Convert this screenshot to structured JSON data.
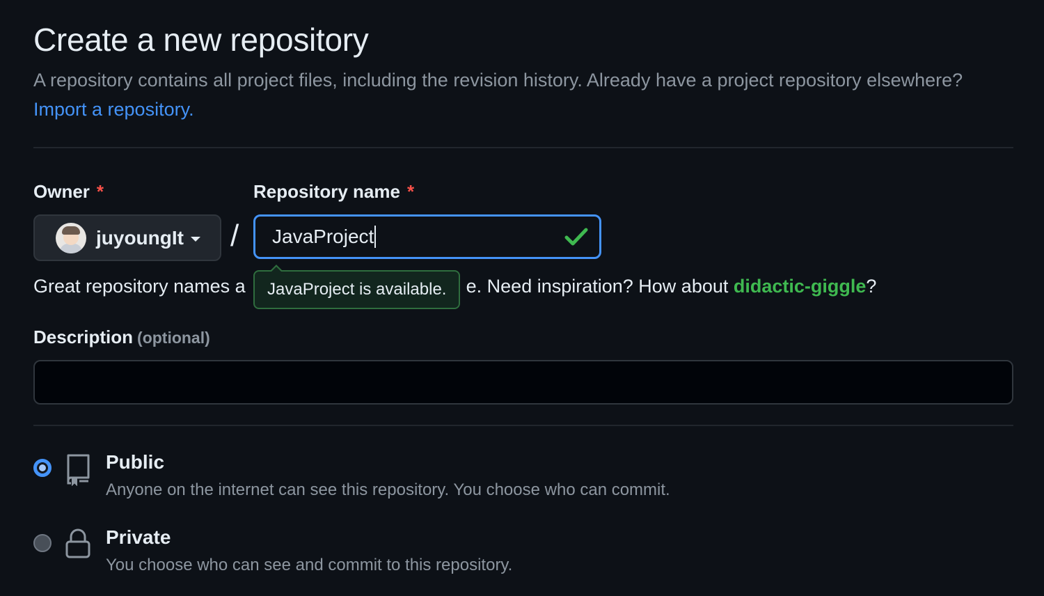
{
  "header": {
    "title": "Create a new repository",
    "subtitle": "A repository contains all project files, including the revision history. Already have a project repository elsewhere?",
    "import_link": "Import a repository."
  },
  "owner": {
    "label": "Owner",
    "required_mark": "*",
    "value": "juyoungIt"
  },
  "separator": "/",
  "repository": {
    "label": "Repository name",
    "required_mark": "*",
    "value": "JavaProject",
    "availability_tooltip": "JavaProject is available."
  },
  "helper": {
    "prefix": "Great repository names a",
    "middle": "e. Need inspiration? How about ",
    "suggestion": "didactic-giggle",
    "suffix": "?"
  },
  "description": {
    "label": "Description",
    "optional": "(optional)",
    "value": ""
  },
  "visibility": {
    "options": [
      {
        "title": "Public",
        "description": "Anyone on the internet can see this repository. You choose who can commit.",
        "selected": true,
        "icon": "repo-icon"
      },
      {
        "title": "Private",
        "description": "You choose who can see and commit to this repository.",
        "selected": false,
        "icon": "lock-icon"
      }
    ]
  },
  "colors": {
    "background": "#0d1117",
    "accent": "#4493f8",
    "success": "#3fb950",
    "danger": "#f85149",
    "muted": "#8d96a0"
  }
}
